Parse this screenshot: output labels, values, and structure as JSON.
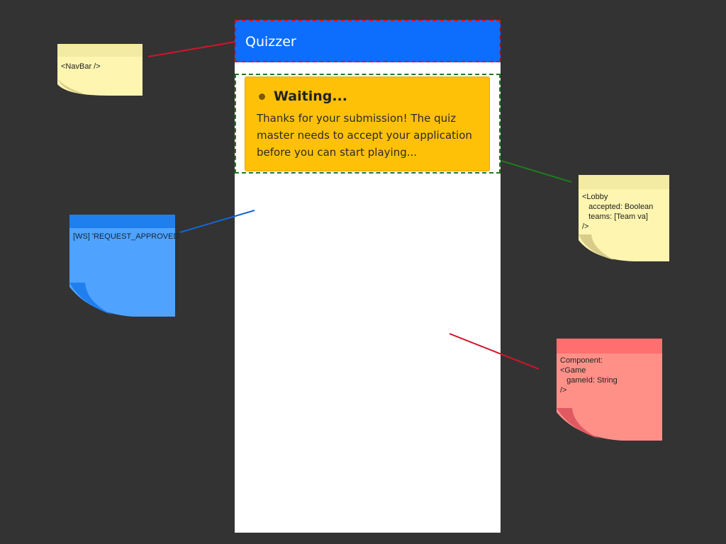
{
  "app": {
    "navbar_brand": "Quizzer",
    "alert": {
      "title": "Waiting...",
      "message": "Thanks for your submission! The quiz master needs to accept your application before you can start playing..."
    }
  },
  "annotations": {
    "navbar_note": "<NavBar />",
    "ws_note": "[WS] 'REQUEST_APPROVED'",
    "lobby_note": "<Lobby\n   accepted: Boolean\n   teams: [Team va]\n/>",
    "game_note": "Component:\n<Game\n   gameId: String\n/>"
  },
  "colors": {
    "background": "#333333",
    "navbar": "#0d6efd",
    "alert_warning": "#ffc107",
    "navbar_outline": "#d3142a",
    "lobby_outline": "#1f7a1f",
    "ws_connector": "#1565d8",
    "game_connector": "#d3142a",
    "note_yellow": "#fdf5b0",
    "note_blue": "#4fa3ff",
    "note_red": "#ff9088"
  }
}
